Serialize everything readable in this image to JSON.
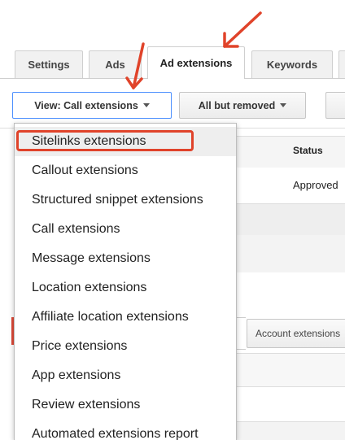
{
  "tabs": [
    {
      "label": "Settings",
      "active": false
    },
    {
      "label": "Ads",
      "active": false
    },
    {
      "label": "Ad extensions",
      "active": true
    },
    {
      "label": "Keywords",
      "active": false
    }
  ],
  "toolbar": {
    "view_label": "View: Call extensions",
    "filter_label": "All but removed"
  },
  "table": {
    "status_header": "Status",
    "status_value": "Approved"
  },
  "account_button": "Account extensions",
  "menu": {
    "items": [
      "Sitelinks extensions",
      "Callout extensions",
      "Structured snippet extensions",
      "Call extensions",
      "Message extensions",
      "Location extensions",
      "Affiliate location extensions",
      "Price extensions",
      "App extensions",
      "Review extensions",
      "Automated extensions report"
    ],
    "highlighted_index": 0
  },
  "colors": {
    "annotation_red": "#e0432a",
    "focus_blue": "#4d90fe"
  }
}
